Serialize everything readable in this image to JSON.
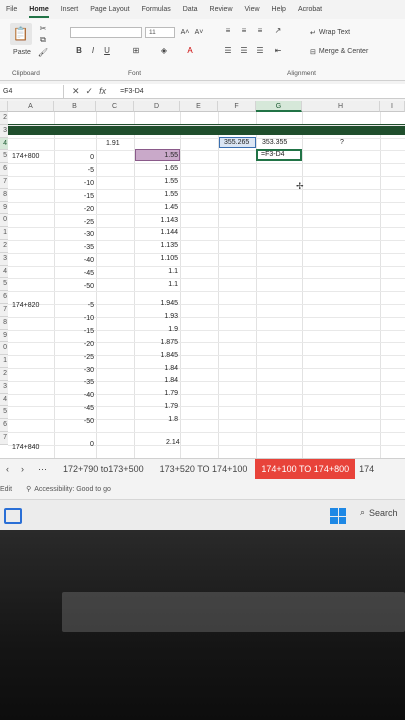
{
  "menu": [
    "File",
    "Home",
    "Insert",
    "Page Layout",
    "Formulas",
    "Data",
    "Review",
    "View",
    "Help",
    "Acrobat"
  ],
  "ribbon": {
    "paste_label": "Paste",
    "clipboard_label": "Clipboard",
    "font_label": "Font",
    "alignment_label": "Alignment",
    "wrap_text_label": "Wrap Text",
    "merge_center_label": "Merge & Center",
    "font_size": "11"
  },
  "formula_bar": {
    "name_box": "G4",
    "formula": "=F3-D4"
  },
  "columns": [
    "A",
    "B",
    "C",
    "D",
    "E",
    "F",
    "G",
    "H",
    "I"
  ],
  "rows": [
    "2",
    "3",
    "4",
    "5",
    "6",
    "7",
    "8",
    "9",
    "0",
    "1",
    "2",
    "3",
    "4",
    "5",
    "6",
    "7",
    "8",
    "9",
    "0",
    "1",
    "2",
    "3",
    "4",
    "5",
    "6",
    "7"
  ],
  "cells": {
    "c_row3": "1.91",
    "f3": "355.265",
    "g3": "353.355",
    "h3": "?",
    "a4": "174+800",
    "g4": "=F3-D4",
    "group1_b": [
      "0",
      "-5",
      "-10",
      "-15",
      "-20",
      "-25",
      "-30",
      "-35",
      "-40",
      "-45",
      "-50"
    ],
    "group1_d": [
      "1.55",
      "1.65",
      "1.55",
      "1.55",
      "1.45",
      "1.143",
      "1.144",
      "1.135",
      "1.105",
      "1.1",
      "1.1"
    ],
    "a16": "174+820",
    "group2_b": [
      "-5",
      "-10",
      "-15",
      "-20",
      "-25",
      "-30",
      "-35",
      "-40",
      "-45",
      "-50"
    ],
    "group2_d": [
      "1.945",
      "1.93",
      "1.9",
      "1.875",
      "1.845",
      "1.84",
      "1.84",
      "1.79",
      "1.79",
      "1.8"
    ],
    "a27": "174+840",
    "b27": "0",
    "d27": "2.14"
  },
  "sheet_tabs": [
    "172+790 to173+500",
    "173+520 TO 174+100",
    "174+100 TO 174+800",
    "174"
  ],
  "status": {
    "mode": "Edit",
    "accessibility": "Accessibility: Good to go"
  },
  "taskbar": {
    "search_label": "Search"
  },
  "colors": {
    "excel_green": "#217346",
    "header_band": "#1f4e2c",
    "active_tab": "#e8433a",
    "selected_cell": "#c9a9c9"
  }
}
